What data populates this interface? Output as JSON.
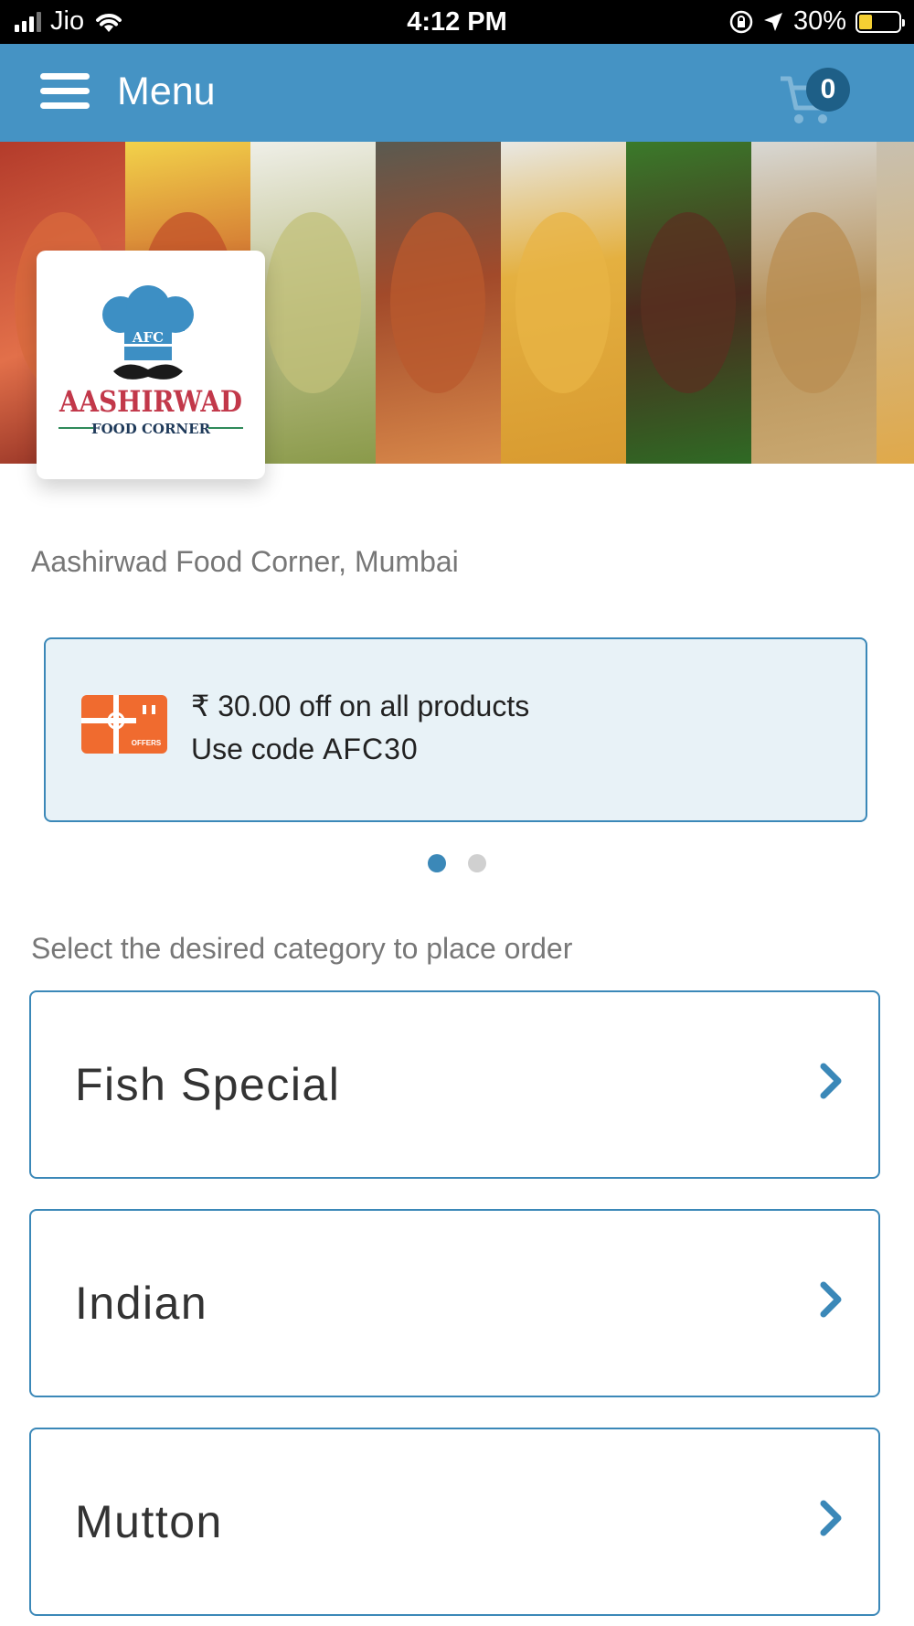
{
  "status_bar": {
    "carrier": "Jio",
    "time": "4:12 PM",
    "battery_percent": "30%",
    "icons": [
      "signal-icon",
      "wifi-icon",
      "orientation-lock-icon",
      "location-icon",
      "battery-charging-icon"
    ]
  },
  "header": {
    "menu_label": "Menu",
    "cart_count": "0",
    "background_color": "#4593c4",
    "badge_color": "#1e5f87"
  },
  "logo": {
    "abbreviation": "AFC",
    "brand_name": "AASHIRWAD",
    "tagline": "FOOD CORNER"
  },
  "restaurant": {
    "name": "Aashirwad Food Corner, Mumbai"
  },
  "offer": {
    "icon_label": "OFFERS",
    "line1": "₹ 30.00 off on all products",
    "line2_prefix": "Use code ",
    "code": "AFC30",
    "slide_count": 2,
    "active_slide": 1
  },
  "instruction": "Select the desired category to place order",
  "categories": [
    {
      "label": "Fish Special"
    },
    {
      "label": "Indian"
    },
    {
      "label": "Mutton"
    }
  ],
  "accent_color": "#3b88b8"
}
